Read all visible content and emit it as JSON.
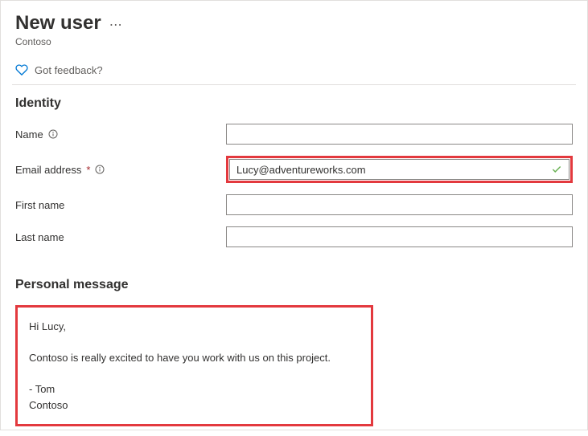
{
  "header": {
    "title": "New user",
    "subtitle": "Contoso"
  },
  "feedback": {
    "label": "Got feedback?"
  },
  "identity": {
    "section_title": "Identity",
    "name_label": "Name",
    "email_label": "Email address",
    "email_value": "Lucy@adventureworks.com",
    "first_name_label": "First name",
    "last_name_label": "Last name"
  },
  "personal_message": {
    "section_title": "Personal message",
    "body": "Hi Lucy,\n\nContoso is really excited to have you work with us on this project.\n\n- Tom\nContoso"
  }
}
